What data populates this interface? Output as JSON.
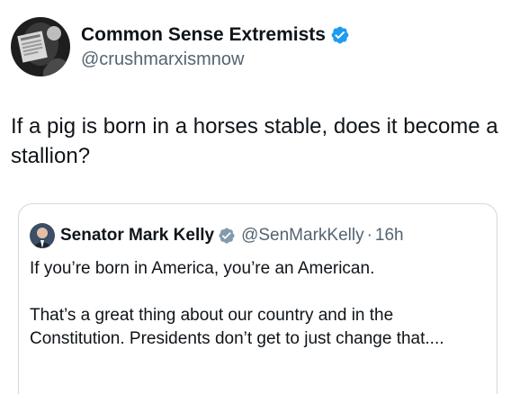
{
  "author": {
    "display_name": "Common Sense Extremists",
    "handle": "@crushmarxismnow",
    "verified_color": "#1d9bf0"
  },
  "post": {
    "text": "If a pig is born in a horses stable, does it become a stallion?"
  },
  "quoted": {
    "display_name": "Senator Mark Kelly",
    "handle": "@SenMarkKelly",
    "separator": "·",
    "time": "16h",
    "verified_color": "#829aab",
    "paragraph_1": "If you’re born in America, you’re an American.",
    "paragraph_2": "That’s a great thing about our country and in the Constitution. Presidents don’t get to just change that...."
  }
}
